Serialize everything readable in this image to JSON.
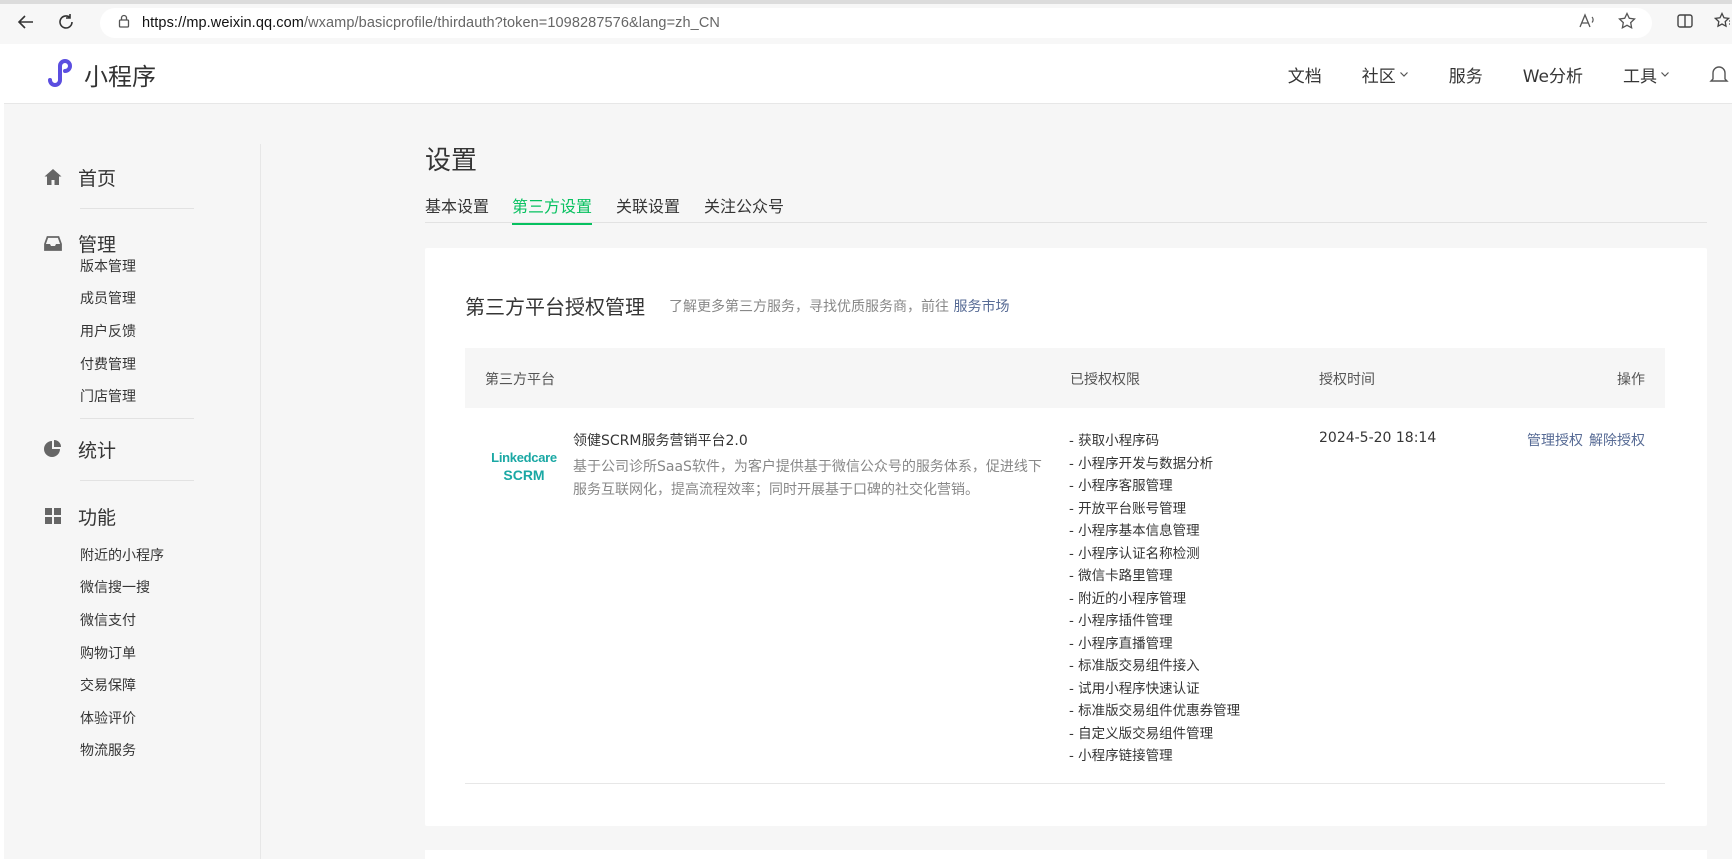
{
  "browser": {
    "url_host": "https://mp.weixin.qq.com",
    "url_rest": "/wxamp/basicprofile/thirdauth?token=1098287576&lang=zh_CN"
  },
  "header": {
    "logo_text": "小程序",
    "nav": [
      {
        "label": "文档",
        "dropdown": false
      },
      {
        "label": "社区",
        "dropdown": true
      },
      {
        "label": "服务",
        "dropdown": false
      },
      {
        "label": "We分析",
        "dropdown": false
      },
      {
        "label": "工具",
        "dropdown": true
      }
    ]
  },
  "sidebar": {
    "home": "首页",
    "manage": "管理",
    "manage_items": [
      "版本管理",
      "成员管理",
      "用户反馈",
      "付费管理",
      "门店管理"
    ],
    "stats": "统计",
    "features": "功能",
    "feature_items": [
      "附近的小程序",
      "微信搜一搜",
      "微信支付",
      "购物订单",
      "交易保障",
      "体验评价",
      "物流服务"
    ]
  },
  "page": {
    "title": "设置",
    "tabs": [
      "基本设置",
      "第三方设置",
      "关联设置",
      "关注公众号"
    ],
    "active_tab": 1
  },
  "card": {
    "title": "第三方平台授权管理",
    "hint": "了解更多第三方服务，寻找优质服务商，前往",
    "hint_link": "服务市场",
    "columns": [
      "第三方平台",
      "已授权权限",
      "授权时间",
      "操作"
    ],
    "row": {
      "logo_line1": "Linkedcare",
      "logo_line2": "SCRM",
      "name": "领健SCRM服务营销平台2.0",
      "description": "基于公司诊所SaaS软件，为客户提供基于微信公众号的服务体系，促进线下服务互联网化，提高流程效率；同时开展基于口碑的社交化营销。",
      "permissions": [
        "- 获取小程序码",
        "- 小程序开发与数据分析",
        "- 小程序客服管理",
        "- 开放平台账号管理",
        "- 小程序基本信息管理",
        "- 小程序认证名称检测",
        "- 微信卡路里管理",
        "- 附近的小程序管理",
        "- 小程序插件管理",
        "- 小程序直播管理",
        "- 标准版交易组件接入",
        "- 试用小程序快速认证",
        "- 标准版交易组件优惠券管理",
        "- 自定义版交易组件管理",
        "- 小程序链接管理"
      ],
      "auth_time": "2024-5-20 18:14",
      "op_manage": "管理授权",
      "op_revoke": "解除授权"
    }
  },
  "colors": {
    "accent": "#07c160",
    "link": "#576b95",
    "logo_purple": "#5b4ee0",
    "logo_teal": "#1aa8a4"
  }
}
